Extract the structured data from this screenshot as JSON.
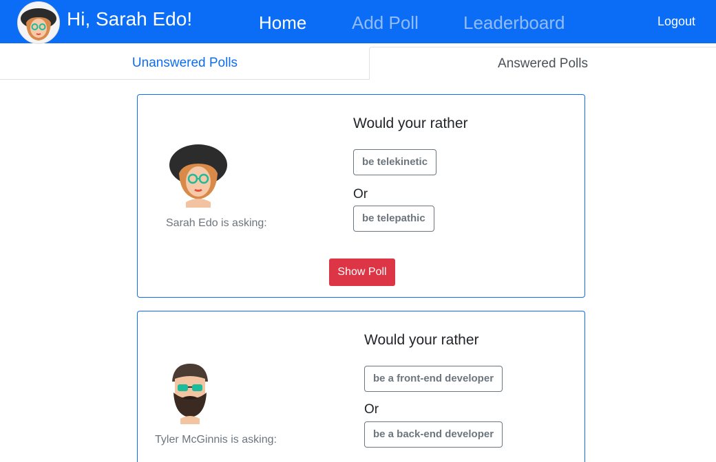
{
  "navbar": {
    "greeting": "Hi, Sarah Edo!",
    "links": [
      "Home",
      "Add Poll",
      "Leaderboard"
    ],
    "logout": "Logout",
    "bg_color": "#0b6cf5"
  },
  "tabs": [
    {
      "label": "Unanswered Polls"
    },
    {
      "label": "Answered Polls"
    }
  ],
  "polls": [
    {
      "asker_label": "Sarah Edo is asking:",
      "title": "Would your rather",
      "option_one": "be telekinetic",
      "or_label": "Or",
      "option_two": "be telepathic",
      "button": "Show Poll",
      "avatar_icon": "woman-with-hat-glasses-avatar"
    },
    {
      "asker_label": "Tyler McGinnis is asking:",
      "title": "Would your rather",
      "option_one": "be a front-end developer",
      "or_label": "Or",
      "option_two": "be a back-end developer",
      "avatar_icon": "bearded-man-glasses-avatar"
    }
  ],
  "colors": {
    "accent": "#0b6cf5",
    "danger": "#dc3545",
    "muted": "#6c757d"
  }
}
